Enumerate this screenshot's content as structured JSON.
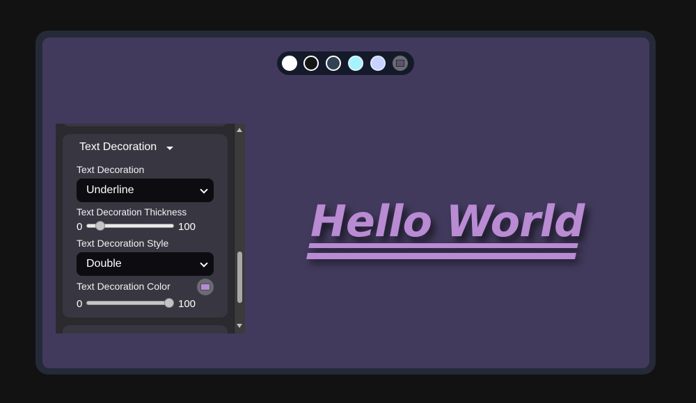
{
  "palette": {
    "swatches": [
      {
        "name": "white",
        "color": "#ffffff"
      },
      {
        "name": "black",
        "color": "#151515"
      },
      {
        "name": "slate",
        "color": "#334155"
      },
      {
        "name": "cyan",
        "color": "#a5f3fc"
      },
      {
        "name": "lavender",
        "color": "#c7d2fe"
      }
    ],
    "custom_icon": "color-picker-icon"
  },
  "panel": {
    "section_title": "Text Decoration",
    "section_icon": "caret-down-icon",
    "fields": {
      "decoration_label": "Text Decoration",
      "decoration_value": "Underline",
      "thickness_label": "Text Decoration Thickness",
      "thickness_min": "0",
      "thickness_max": "100",
      "thickness_value": 15,
      "style_label": "Text Decoration Style",
      "style_value": "Double",
      "color_label": "Text Decoration Color",
      "color_value": "#b98bd3",
      "opacity_min": "0",
      "opacity_max": "100",
      "opacity_value": 100
    }
  },
  "preview": {
    "text": "Hello World",
    "text_color": "#b98bd3",
    "background": "#413a5c"
  }
}
